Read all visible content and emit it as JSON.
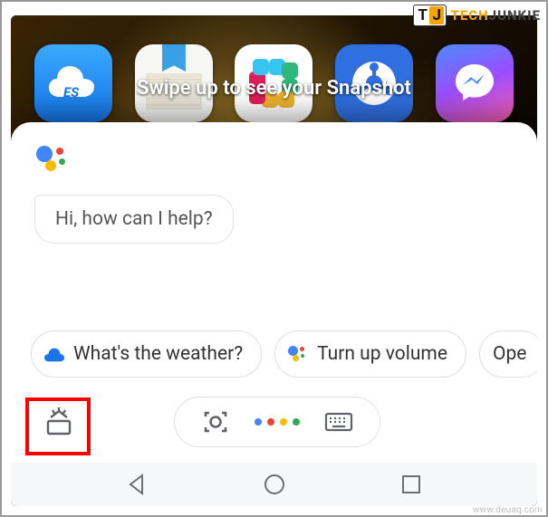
{
  "watermark": {
    "brand_left": "T",
    "brand_right": "J",
    "text_a": "TECH",
    "text_b": "JUNKIE"
  },
  "toast": {
    "text": "Swipe up to see your Snapshot"
  },
  "assistant": {
    "greeting": "Hi, how can I help?",
    "suggestions": [
      {
        "icon": "cloud",
        "label": "What's the weather?"
      },
      {
        "icon": "assistant",
        "label": "Turn up volume"
      },
      {
        "icon": "none",
        "label": "Ope"
      }
    ]
  },
  "apps": [
    {
      "name": "ES File Explorer"
    },
    {
      "name": "Notes"
    },
    {
      "name": "Slack"
    },
    {
      "name": "SHAREit"
    },
    {
      "name": "Messenger"
    }
  ],
  "source_watermark": "www.deuaq.com"
}
